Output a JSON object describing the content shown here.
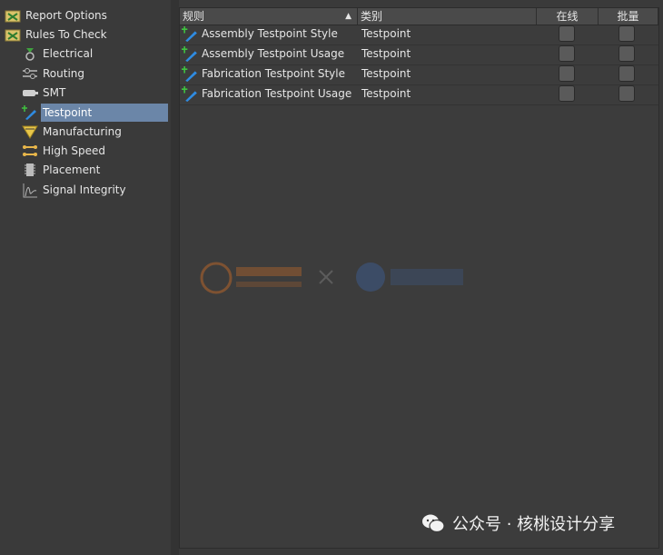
{
  "tree": {
    "items": [
      {
        "label": "Report Options",
        "icon": "report-options-icon"
      },
      {
        "label": "Rules To Check",
        "icon": "rules-to-check-icon"
      },
      {
        "label": "Electrical",
        "icon": "electrical-icon"
      },
      {
        "label": "Routing",
        "icon": "routing-icon"
      },
      {
        "label": "SMT",
        "icon": "smt-icon"
      },
      {
        "label": "Testpoint",
        "icon": "testpoint-icon"
      },
      {
        "label": "Manufacturing",
        "icon": "manufacturing-icon"
      },
      {
        "label": "High Speed",
        "icon": "high-speed-icon"
      },
      {
        "label": "Placement",
        "icon": "placement-icon"
      },
      {
        "label": "Signal Integrity",
        "icon": "signal-integrity-icon"
      }
    ]
  },
  "table": {
    "columns": {
      "rule": "规则",
      "category": "类别",
      "online": "在线",
      "batch": "批量"
    },
    "rows": [
      {
        "rule": "Assembly Testpoint Style",
        "category": "Testpoint"
      },
      {
        "rule": "Assembly Testpoint Usage",
        "category": "Testpoint"
      },
      {
        "rule": "Fabrication Testpoint Style",
        "category": "Testpoint"
      },
      {
        "rule": "Fabrication Testpoint Usage",
        "category": "Testpoint"
      }
    ]
  },
  "watermark": {
    "text": "公众号 · 核桃设计分享"
  },
  "colors": {
    "selection": "#6b86a8",
    "background": "#3a3a3a",
    "header": "#4a4a4a"
  }
}
